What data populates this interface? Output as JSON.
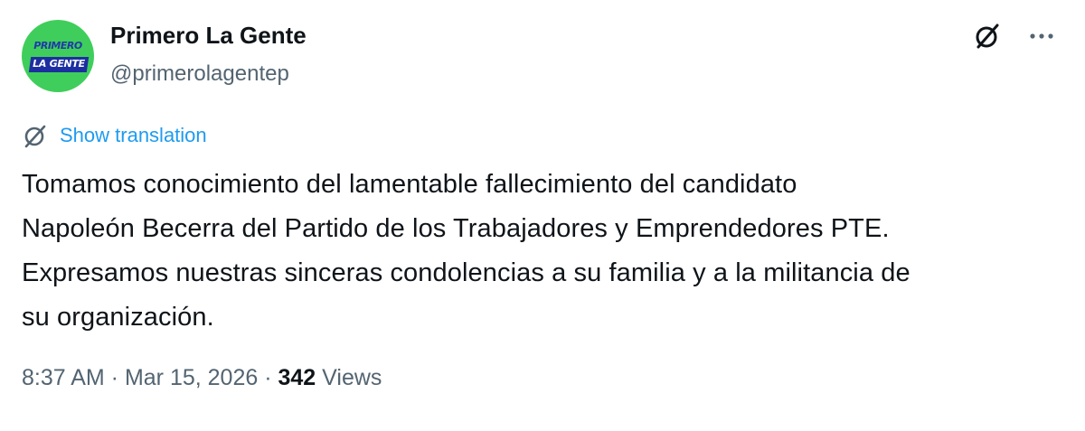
{
  "account": {
    "display_name": "Primero La Gente",
    "handle": "@primerolagentep",
    "avatar_logo_top": "PRIMERO",
    "avatar_logo_bottom": "LA GENTE"
  },
  "icons": {
    "grok": "grok-icon",
    "more": "more-icon",
    "translate": "translate-icon"
  },
  "translate": {
    "label": "Show translation"
  },
  "tweet": {
    "lines": [
      "Tomamos conocimiento del lamentable fallecimiento del candidato",
      "Napoleón Becerra del Partido de los Trabajadores y Emprendedores PTE.",
      "Expresamos nuestras sinceras condolencias a su familia y a la militancia de",
      "su organización."
    ]
  },
  "meta": {
    "time": "8:37 AM",
    "separator": " · ",
    "date": "Mar 15, 2026",
    "views_count": "342",
    "views_label": " Views"
  },
  "colors": {
    "accent": "#1d9bf0",
    "text": "#0f1419",
    "secondary": "#536471",
    "avatar_bg": "#3fce5b",
    "avatar_band": "#1d2fa0"
  }
}
